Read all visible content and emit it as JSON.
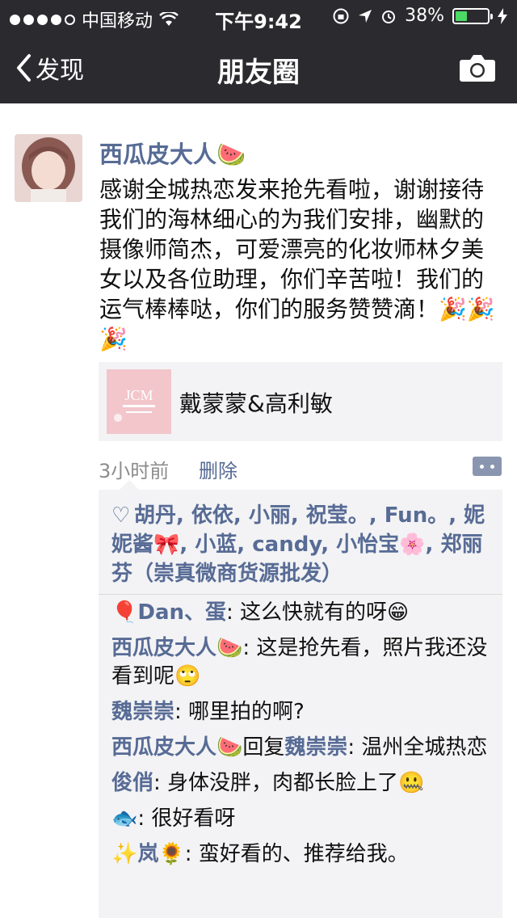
{
  "status": {
    "carrier": "中国移动",
    "time": "下午9:42",
    "battery": "38%",
    "battery_level": 0.38
  },
  "nav": {
    "back_label": "发现",
    "title": "朋友圈"
  },
  "post": {
    "author": "西瓜皮大人🍉",
    "content": "感谢全城热恋发来抢先看啦，谢谢接待我们的海林细心的为我们安排，幽默的摄像师简杰，可爱漂亮的化妆师林夕美女以及各位助理，你们辛苦啦！我们的运气棒棒哒，你们的服务赞赞滴！🎉🎉🎉",
    "link_title": "戴蒙蒙&高利敏",
    "link_thumb_text": "JCM",
    "time": "3小时前",
    "delete_label": "删除"
  },
  "likes": "胡丹, 依依, 小丽, 祝莹。, Fun。, 妮妮酱🎀, 小蓝, candy, 小怡宝🌸, 郑丽芬（崇真微商货源批发）",
  "comments": [
    {
      "name": "🎈Dan、蛋",
      "text": ": 这么快就有的呀😁"
    },
    {
      "name": "西瓜皮大人🍉",
      "text": ": 这是抢先看，照片我还没看到呢🙄"
    },
    {
      "name": "魏崇崇",
      "text": ": 哪里拍的啊?"
    },
    {
      "name": "西瓜皮大人🍉",
      "mid": "回复",
      "reply_to": "魏崇崇",
      "text": ": 温州全城热恋"
    },
    {
      "name": "俊俏",
      "text": ": 身体没胖，肉都长脸上了🤐"
    },
    {
      "name": "🐟",
      "text": ": 很好看呀"
    },
    {
      "name": "✨岚🌻",
      "text": ": 蛮好看的、推荐给我。"
    }
  ]
}
